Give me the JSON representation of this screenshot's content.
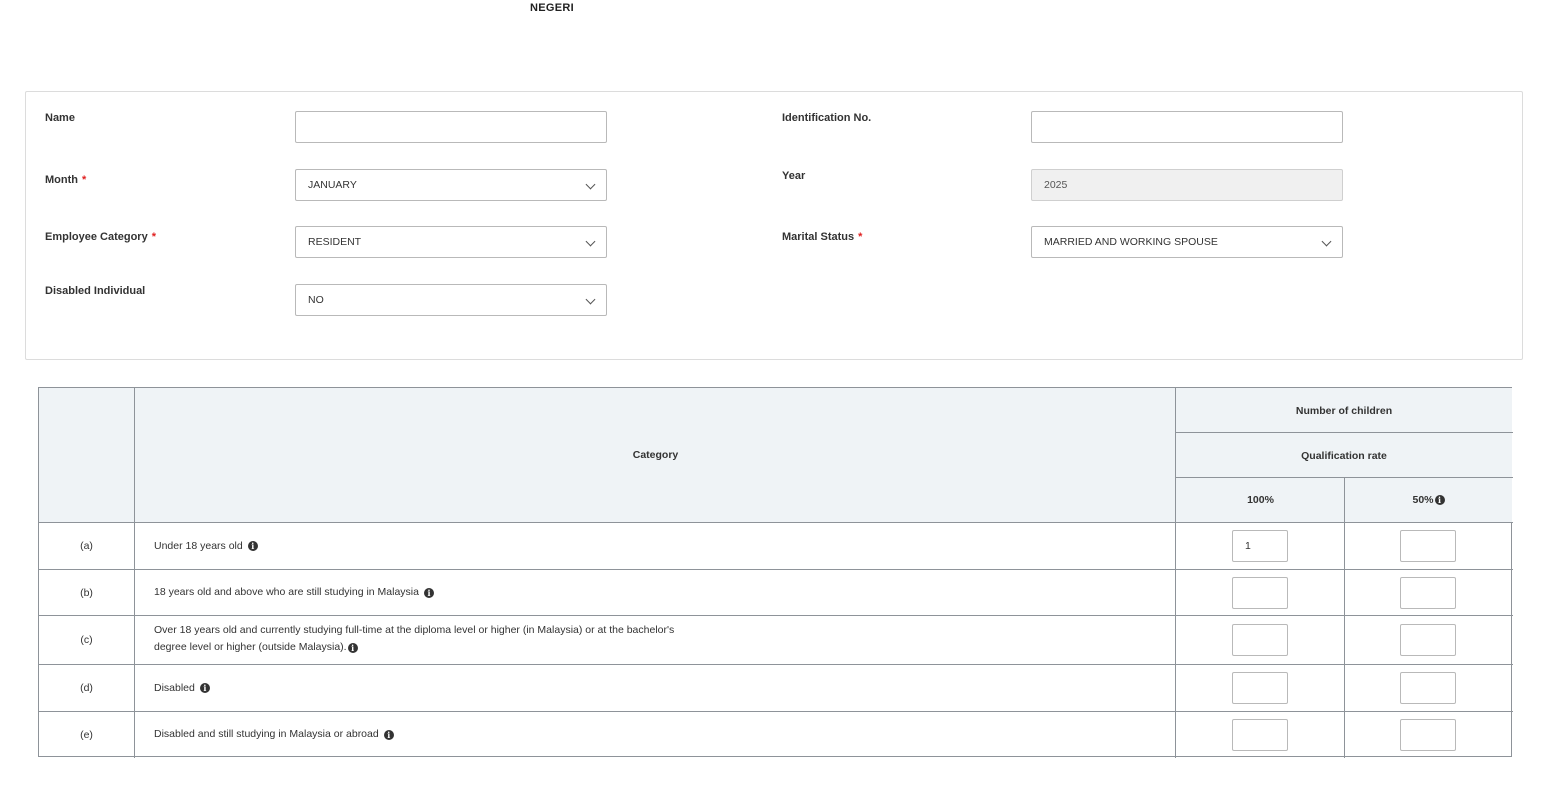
{
  "header": {
    "top_label": "NEGERI"
  },
  "form": {
    "name": {
      "label": "Name",
      "value": ""
    },
    "identification": {
      "label": "Identification No.",
      "value": ""
    },
    "month": {
      "label": "Month",
      "value": "JANUARY",
      "required": true
    },
    "year": {
      "label": "Year",
      "value": "2025"
    },
    "employee_category": {
      "label": "Employee Category",
      "value": "RESIDENT",
      "required": true
    },
    "marital_status": {
      "label": "Marital Status",
      "value": "MARRIED AND WORKING SPOUSE",
      "required": true
    },
    "disabled_individual": {
      "label": "Disabled Individual",
      "value": "NO"
    },
    "required_mark": "*"
  },
  "table": {
    "headers": {
      "category": "Category",
      "number_of_children": "Number of children",
      "qualification_rate": "Qualification rate",
      "rate_100": "100%",
      "rate_50": "50%"
    },
    "rows": [
      {
        "code": "(a)",
        "text": "Under 18 years old",
        "text2": "",
        "v100": "1",
        "v50": ""
      },
      {
        "code": "(b)",
        "text": "18 years old and above who are still studying in Malaysia",
        "text2": "",
        "v100": "",
        "v50": ""
      },
      {
        "code": "(c)",
        "text": "Over 18 years old and currently studying full-time at the diploma level or higher (in Malaysia) or at the bachelor's",
        "text2": "degree level or higher (outside Malaysia).",
        "v100": "",
        "v50": ""
      },
      {
        "code": "(d)",
        "text": "Disabled",
        "text2": "",
        "v100": "",
        "v50": ""
      },
      {
        "code": "(e)",
        "text": "Disabled and still studying in Malaysia or abroad",
        "text2": "",
        "v100": "",
        "v50": ""
      }
    ]
  }
}
